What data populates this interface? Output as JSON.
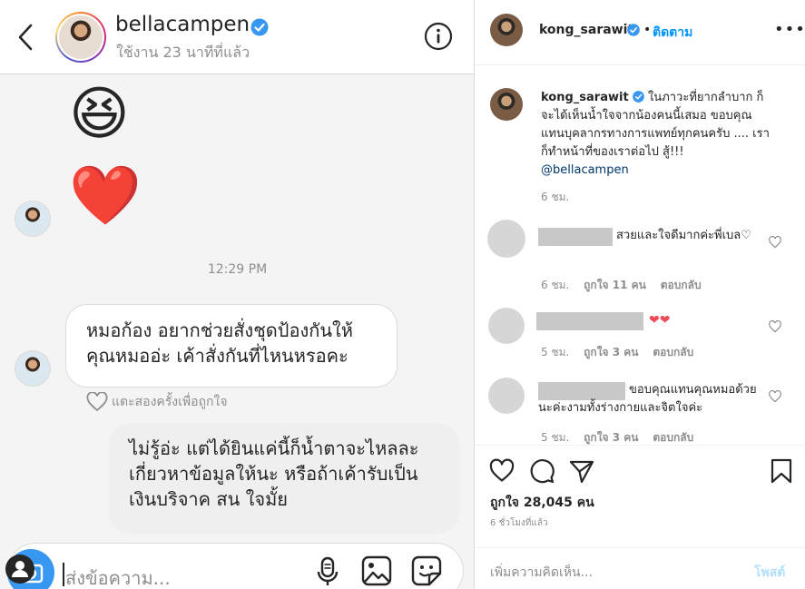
{
  "dm": {
    "username": "bellacampen",
    "status": "ใช้งาน 23 นาทีที่แล้ว",
    "emoji_1": "😆",
    "emoji_2": "❤️",
    "timestamp": "12:29 PM",
    "message_in": "หมอก้อง อยากช่วยสั่งชุดป้องกันให้คุณหมออ่ะ เค้าสั่งกันที่ไหนหรอคะ",
    "like_hint": "แตะสองครั้งเพื่อถูกใจ",
    "message_out": "ไม่รู้อ่ะ แต่ได้ยินแค่นี้ก็น้ำตาจะไหลละ เกี่ยวหาข้อมูลให้นะ หรือถ้าเค้ารับเป็นเงินบริจาค สน ใจมั้ย",
    "compose_placeholder": "ส่งข้อความ..."
  },
  "post": {
    "username": "kong_sarawit",
    "dot": "•",
    "follow_label": "ติดตาม",
    "more_label": "•••",
    "caption_user": "kong_sarawit",
    "caption_text": "ในภาวะที่ยากลำบาก ก็จะได้เห็นน้ำใจจากน้องคนนี้เสมอ ขอบคุณแทนบุคลากรทางการแพทย์ทุกคนครับ .... เราก็ทำหน้าที่ของเราต่อไป สู้!!!",
    "caption_mention": "@bellacampen",
    "caption_time": "6 ชม.",
    "comments": [
      {
        "text": "สวยและใจดีมากค่ะพี่เบล♡",
        "time": "6 ชม.",
        "likes": "ถูกใจ 11 คน",
        "reply": "ตอบกลับ"
      },
      {
        "text": "❤❤",
        "time": "5 ชม.",
        "likes": "ถูกใจ 3 คน",
        "reply": "ตอบกลับ"
      },
      {
        "text": "ขอบคุณแทนคุณหมอด้วยนะค่ะงามทั้งร่างกายและจิตใจค่ะ",
        "time": "5 ชม.",
        "likes": "ถูกใจ 3 คน",
        "reply": "ตอบกลับ"
      }
    ],
    "likes": "ถูกใจ 28,045 คน",
    "time": "6 ชั่วโมงที่แล้ว",
    "add_comment_placeholder": "เพิ่มความคิดเห็น...",
    "post_label": "โพสต์"
  },
  "colors": {
    "accent": "#0095f6",
    "verified": "#3897f0",
    "heart": "#ed4956"
  }
}
